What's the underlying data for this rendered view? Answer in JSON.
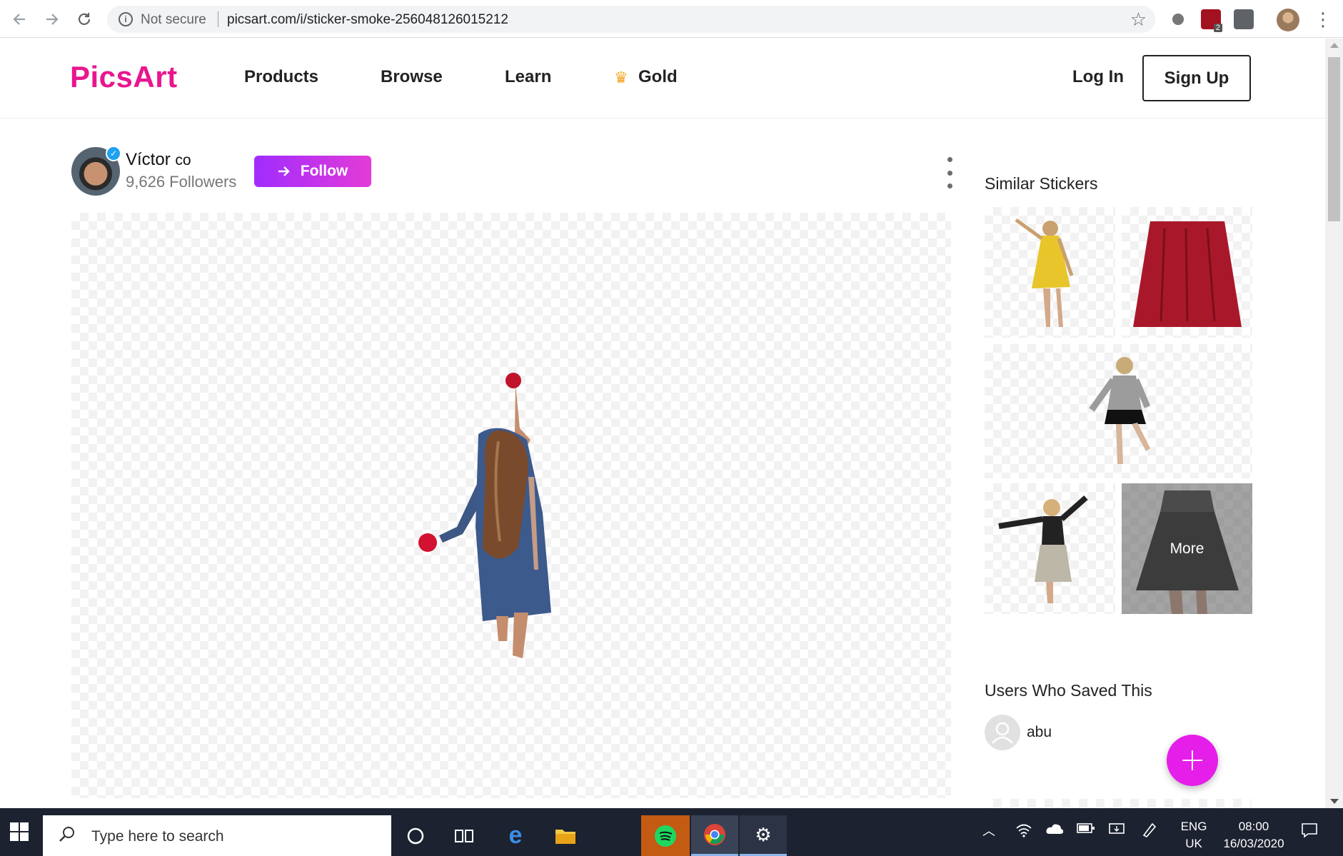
{
  "browser": {
    "security_label": "Not secure",
    "url": "picsart.com/i/sticker-smoke-256048126015212",
    "extension_badge": "2"
  },
  "header": {
    "logo": "PicsArt",
    "nav": [
      "Products",
      "Browse",
      "Learn",
      "Gold"
    ],
    "login_label": "Log In",
    "signup_label": "Sign Up"
  },
  "author": {
    "name": "Víctor",
    "name_suffix": "co",
    "followers": "9,626 Followers",
    "follow_label": "Follow"
  },
  "sidebar": {
    "similar_title": "Similar Stickers",
    "more_label": "More",
    "saved_title": "Users Who Saved This",
    "savers": [
      "abu"
    ]
  },
  "taskbar": {
    "search_placeholder": "Type here to search",
    "lang_top": "ENG",
    "lang_bottom": "UK",
    "time": "08:00",
    "date": "16/03/2020"
  },
  "colors": {
    "brand": "#e8168f",
    "follow_gradient_start": "#a02cff",
    "follow_gradient_end": "#e33bd7",
    "fab": "#e61ee9"
  }
}
